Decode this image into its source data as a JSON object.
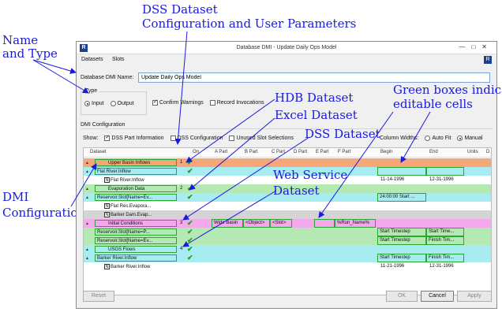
{
  "annotations": {
    "dss_top_1": "DSS Dataset",
    "dss_top_2": "Configuration and User Parameters",
    "name_type_1": "Name",
    "name_type_2": "and Type",
    "hdb": "HDB Dataset",
    "excel": "Excel Dataset",
    "dss_mid": "DSS Dataset",
    "web_1": "Web Service",
    "web_2": "Dataset",
    "green_1": "Green boxes indicate",
    "green_2": "editable cells",
    "dmi_1": "DMI",
    "dmi_2": "Configuration"
  },
  "window": {
    "title": "Database DMI - Update Daily Ops Model",
    "app_icon": "R",
    "help_icon": "R",
    "menus": [
      "Datasets",
      "Slots"
    ]
  },
  "form": {
    "name_label": "Database DMI Name:",
    "name_value": "Update Daily Ops Model",
    "type_legend": "Type",
    "input_label": "Input",
    "output_label": "Output",
    "confirm_warnings": "Confirm Warnings",
    "record_invocations": "Record Invocations"
  },
  "dmi_config": {
    "section_label": "DMI Configuration",
    "show_label": "Show:",
    "dss_part_info": "DSS Part Information",
    "dss_config": "DSS Configuration",
    "unused_slot": "Unused Slot Selections",
    "column_widths": "Column Widths:",
    "auto_fit": "Auto Fit",
    "manual": "Manual"
  },
  "grid": {
    "headers": [
      "Dataset",
      "On",
      "A Part",
      "B Part",
      "C Part",
      "D Part",
      "E Part",
      "F Part",
      "Begin",
      "End",
      "Units",
      "D"
    ],
    "rows": [
      {
        "label": "Upper Basin Inflows",
        "num": "1",
        "begin": "",
        "end": ""
      },
      {
        "label": "Flat River.Inflow",
        "begin": "",
        "end": ""
      },
      {
        "label": "Flat River.Inflow",
        "begin": "11-14-1996",
        "end": "12-31-1996"
      },
      {
        "label": "Evaporation Data",
        "num": "2"
      },
      {
        "label": "Reservoir.Slot[Name=Ev...",
        "begin": "24:00:00 Start ..."
      },
      {
        "label": "Flat Res.Evapora..."
      },
      {
        "label": "Barker Dam.Evap..."
      },
      {
        "label": "Initial Conditions",
        "num": "3",
        "a": "Wide Basin",
        "b": "<Object>",
        "c": "<Slot>",
        "f": "%Run_Name%"
      },
      {
        "label": "Reservoir.Slot[Name=P...",
        "begin": "Start Timestep",
        "end": "Start Time..."
      },
      {
        "label": "Reservoir.Slot[Name=Ev...",
        "begin": "Start Timestep",
        "end": "Finish Tim..."
      },
      {
        "label": "USGS Flows",
        "num": "4"
      },
      {
        "label": "Barker River.Inflow",
        "begin": "Start Timestep",
        "end": "Finish Tim..."
      },
      {
        "label": "Barker River.Inflow",
        "begin": "11-21-1996",
        "end": "12-31-1996"
      }
    ]
  },
  "buttons": {
    "reset": "Reset",
    "ok": "OK",
    "cancel": "Cancel",
    "apply": "Apply"
  },
  "colors": {
    "orange": "#f6a77a",
    "cyan": "#a6ecf1",
    "green": "#b5e9b4",
    "gray": "#d4d4d4",
    "pink": "#f3a9ec",
    "edit_border": "#2aa632",
    "annotation": "#1a1adb"
  }
}
